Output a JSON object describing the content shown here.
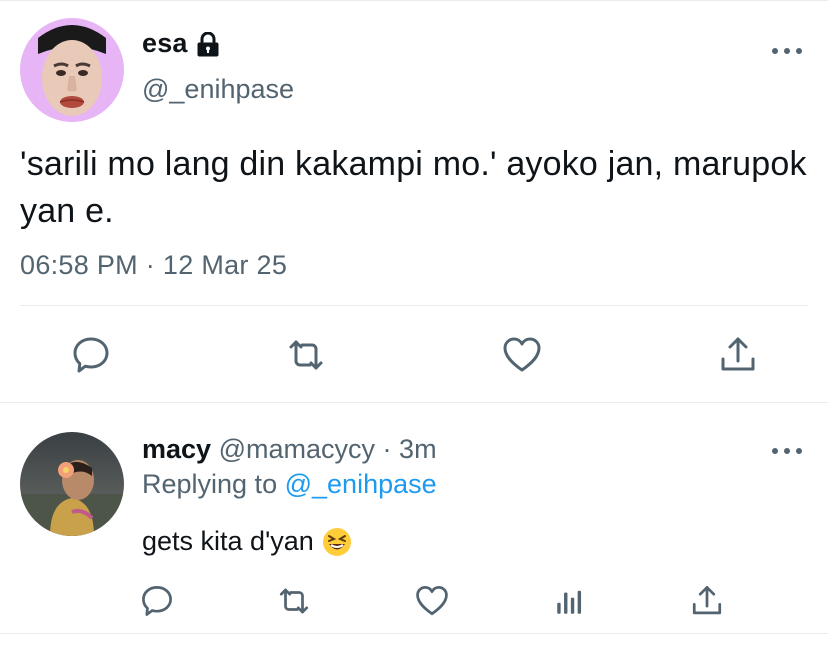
{
  "main_tweet": {
    "display_name": "esa",
    "handle": "@_enihpase",
    "text": "'sarili mo lang din kakampi mo.' ayoko jan, marupok yan e.",
    "time": "06:58 PM",
    "separator": "·",
    "date": "12 Mar 25",
    "icons": [
      "lock-icon",
      "more-icon",
      "reply-icon",
      "retweet-icon",
      "like-icon",
      "share-icon"
    ]
  },
  "reply": {
    "display_name": "macy",
    "handle": "@mamacycy",
    "separator": "·",
    "time_ago": "3m",
    "replying_prefix": "Replying to",
    "replying_handle": "@_enihpase",
    "text": "gets kita d'yan",
    "emoji": "grinning-squinting-face",
    "icons": [
      "reply-icon",
      "retweet-icon",
      "like-icon",
      "analytics-icon",
      "share-icon"
    ]
  },
  "colors": {
    "text": "#0f1419",
    "secondary": "#536471",
    "link": "#1d9bf0",
    "divider": "#e6ecf0",
    "avatar_bg_main": "#e7b5f5"
  }
}
